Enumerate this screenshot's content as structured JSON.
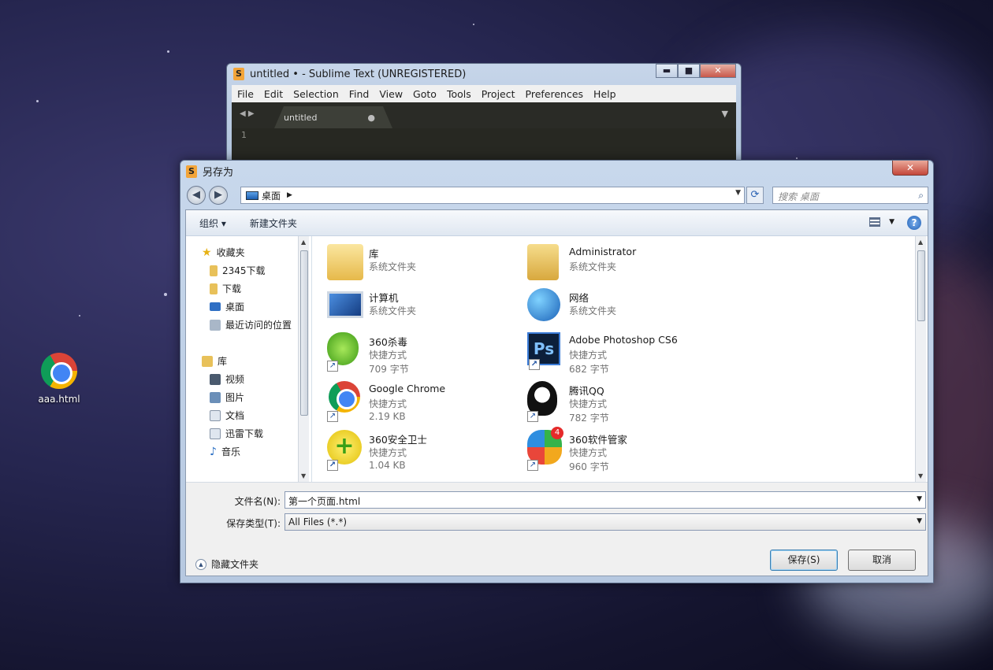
{
  "desktop": {
    "icon_label": "aaa.html"
  },
  "sublime": {
    "title": "untitled • - Sublime Text (UNREGISTERED)",
    "menu": [
      "File",
      "Edit",
      "Selection",
      "Find",
      "View",
      "Goto",
      "Tools",
      "Project",
      "Preferences",
      "Help"
    ],
    "tab_label": "untitled",
    "tab_dot": "●",
    "line_number": "1",
    "min": "▬",
    "max": "■",
    "close": "✕"
  },
  "dialog": {
    "title": "另存为",
    "close": "✕",
    "address": "桌面",
    "search_placeholder": "搜索 桌面",
    "toolbar": {
      "organize": "组织 ▾",
      "new_folder": "新建文件夹",
      "help": "?"
    },
    "sidebar": {
      "favorites": "收藏夹",
      "fav_items": [
        "2345下载",
        "下载",
        "桌面",
        "最近访问的位置"
      ],
      "libraries": "库",
      "lib_items": [
        "视频",
        "图片",
        "文档",
        "迅雷下载",
        "音乐"
      ]
    },
    "files": [
      {
        "name": "库",
        "type": "系统文件夹",
        "size": ""
      },
      {
        "name": "Administrator",
        "type": "系统文件夹",
        "size": ""
      },
      {
        "name": "计算机",
        "type": "系统文件夹",
        "size": ""
      },
      {
        "name": "网络",
        "type": "系统文件夹",
        "size": ""
      },
      {
        "name": "360杀毒",
        "type": "快捷方式",
        "size": "709 字节"
      },
      {
        "name": "Adobe Photoshop CS6",
        "type": "快捷方式",
        "size": "682 字节"
      },
      {
        "name": "Google Chrome",
        "type": "快捷方式",
        "size": "2.19 KB"
      },
      {
        "name": "腾讯QQ",
        "type": "快捷方式",
        "size": "782 字节"
      },
      {
        "name": "360安全卫士",
        "type": "快捷方式",
        "size": "1.04 KB"
      },
      {
        "name": "360软件管家",
        "type": "快捷方式",
        "size": "960 字节"
      }
    ],
    "filename_label": "文件名(N):",
    "filename_value": "第一个页面.html",
    "filetype_label": "保存类型(T):",
    "filetype_value": "All Files (*.*)",
    "save_label": "保存(S)",
    "cancel_label": "取消",
    "hide_folders_label": "隐藏文件夹",
    "badge_360": "4"
  }
}
